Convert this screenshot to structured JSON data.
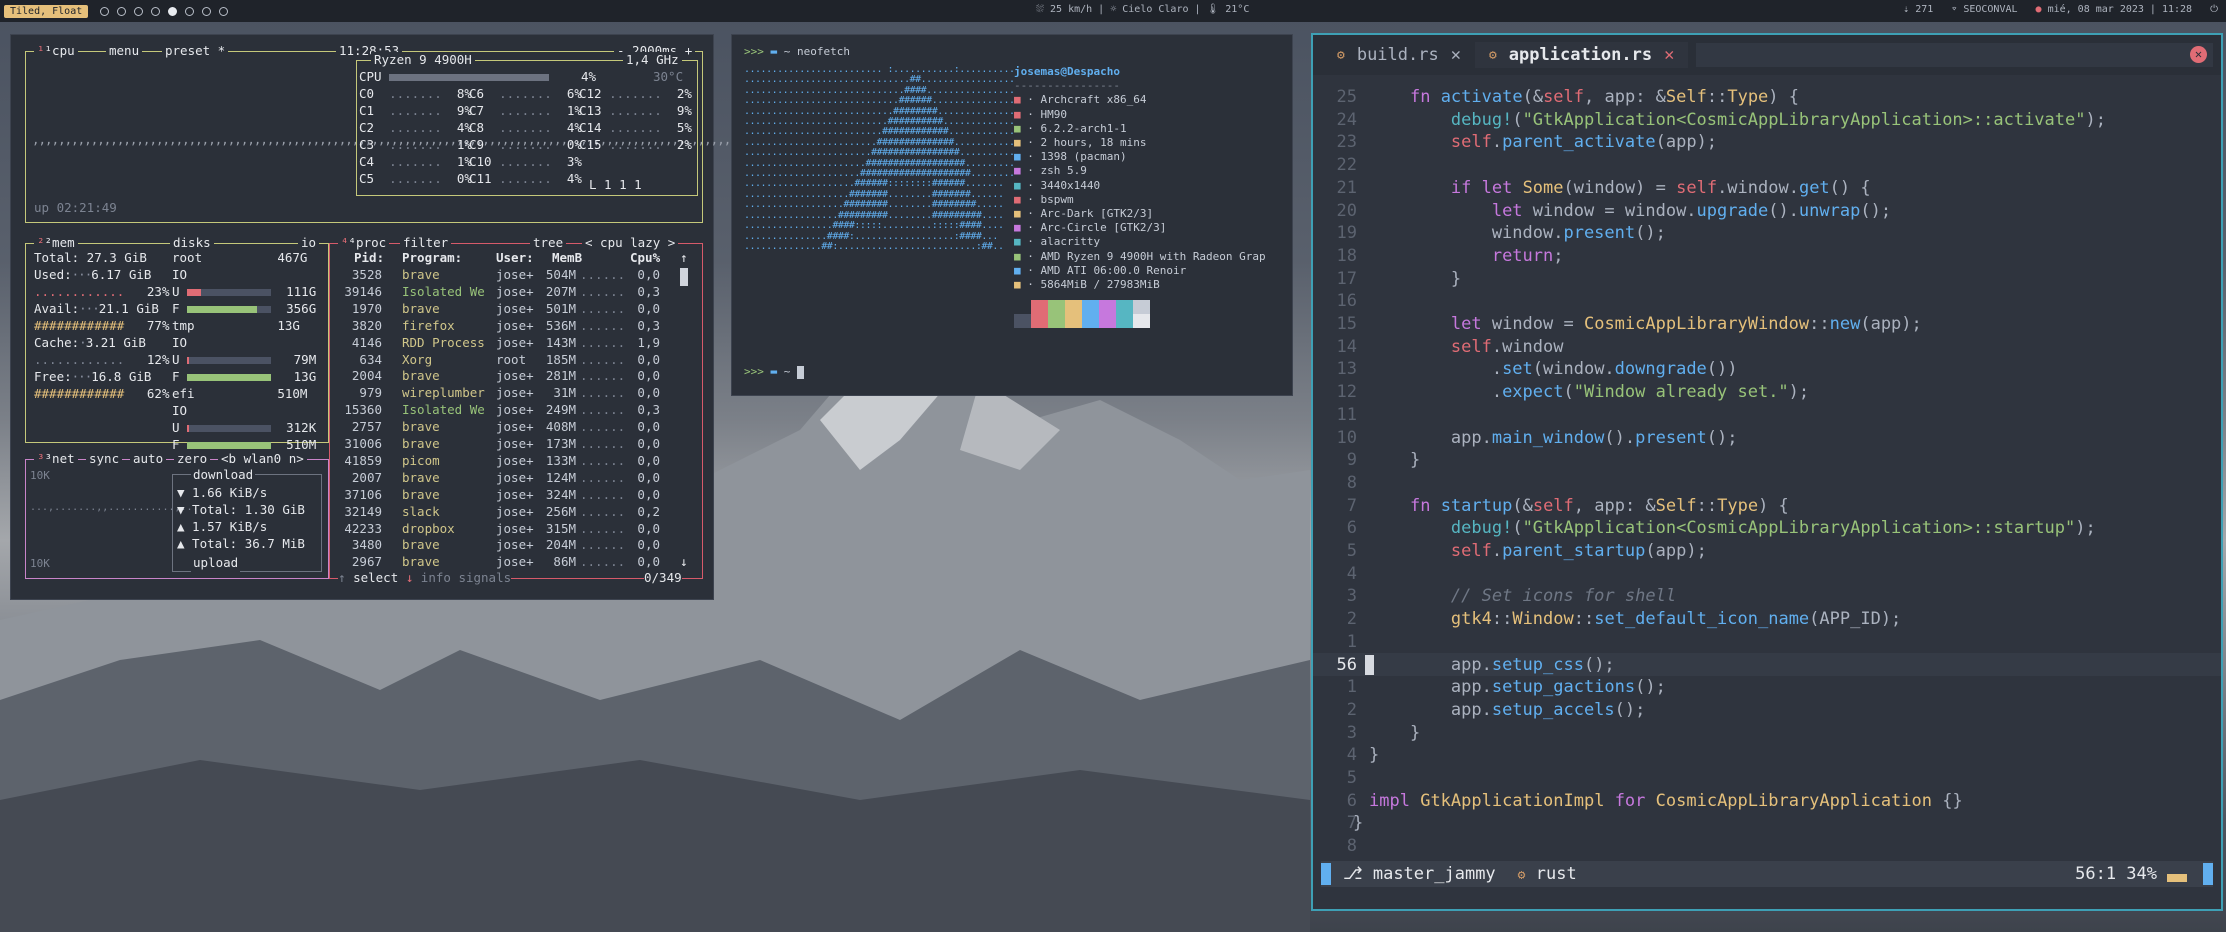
{
  "topbar": {
    "layout": "Tiled, Float",
    "center": "⛆ 25 km/h | ☼ Cielo Claro | 🌡 21°C",
    "updates": "271",
    "wifi": "SEOCONVAL",
    "datetime": "mié, 08 mar 2023 | 11:28"
  },
  "btop": {
    "cpu_title": "¹cpu",
    "menu": "menu",
    "preset": "preset *",
    "clock": "11:28:53",
    "interval": "- 2000ms +",
    "cpu_model": "Ryzen 9 4900H",
    "freq": "1,4 GHz",
    "cpu_total_label": "CPU",
    "cpu_total": "4%",
    "cpu_temp": "30°C",
    "cores": [
      [
        "C0",
        "8%"
      ],
      [
        "C1",
        "9%"
      ],
      [
        "C2",
        "4%"
      ],
      [
        "C3",
        "1%"
      ],
      [
        "C4",
        "1%"
      ],
      [
        "C5",
        "0%"
      ],
      [
        "C6",
        "6%"
      ],
      [
        "C7",
        "1%"
      ],
      [
        "C8",
        "4%"
      ],
      [
        "C9",
        "0%"
      ],
      [
        "C10",
        "3%"
      ],
      [
        "C11",
        "4%"
      ],
      [
        "C12",
        "2%"
      ],
      [
        "C13",
        "9%"
      ],
      [
        "C14",
        "5%"
      ],
      [
        "C15",
        "2%"
      ]
    ],
    "load": "L 1 1 1",
    "uptime": "up 02:21:49",
    "mem_title": "²mem",
    "disks_title": "disks",
    "io_title": "io",
    "mem": {
      "total": "Total: 27.3 GiB",
      "used": "Used:",
      "used_val": "6.17 GiB",
      "used_pct": "23%",
      "avail": "Avail:",
      "avail_val": "21.1 GiB",
      "avail_pct": "77%",
      "cache": "Cache:",
      "cache_val": "3.21 GiB",
      "cache_pct": "12%",
      "free": "Free:",
      "free_val": "16.8 GiB",
      "free_pct": "62%"
    },
    "disks": [
      {
        "name": "root",
        "size": "467G",
        "used": "111G",
        "free": "356G"
      },
      {
        "name": "tmp",
        "size": "13G",
        "used": "79M",
        "free": "13G"
      },
      {
        "name": "efi",
        "size": "510M",
        "used": "312K",
        "free": "510M"
      }
    ],
    "net_title": "³net",
    "net_sync": "sync",
    "net_auto": "auto",
    "net_zero": "zero",
    "net_iface": "<b wlan0 n>",
    "net_scale_top": "10K",
    "net_scale_bot": "10K",
    "net_download": "download",
    "net_down_rate": "▼ 1.66 KiB/s",
    "net_down_total": "▼ Total: 1.30 GiB",
    "net_up_rate": "▲ 1.57 KiB/s",
    "net_up_total": "▲ Total: 36.7 MiB",
    "net_upload": "upload",
    "proc_title": "⁴proc",
    "proc_filter": "filter",
    "proc_tree": "tree",
    "proc_sort": "< cpu lazy >",
    "proc_headers": [
      "Pid:",
      "Program:",
      "User:",
      "MemB",
      "Cpu%"
    ],
    "procs": [
      [
        "3528",
        "brave",
        "jose+",
        "504M",
        "0,0"
      ],
      [
        "39146",
        "Isolated We",
        "jose+",
        "207M",
        "0,3"
      ],
      [
        "1970",
        "brave",
        "jose+",
        "501M",
        "0,0"
      ],
      [
        "3820",
        "firefox",
        "jose+",
        "536M",
        "0,3"
      ],
      [
        "4146",
        "RDD Process",
        "jose+",
        "143M",
        "1,9"
      ],
      [
        "634",
        "Xorg",
        "root",
        "185M",
        "0,0"
      ],
      [
        "2004",
        "brave",
        "jose+",
        "281M",
        "0,0"
      ],
      [
        "979",
        "wireplumber",
        "jose+",
        "31M",
        "0,0"
      ],
      [
        "15360",
        "Isolated We",
        "jose+",
        "249M",
        "0,3"
      ],
      [
        "2757",
        "brave",
        "jose+",
        "408M",
        "0,0"
      ],
      [
        "31006",
        "brave",
        "jose+",
        "173M",
        "0,0"
      ],
      [
        "41859",
        "picom",
        "jose+",
        "133M",
        "0,0"
      ],
      [
        "2007",
        "brave",
        "jose+",
        "124M",
        "0,0"
      ],
      [
        "37106",
        "brave",
        "jose+",
        "324M",
        "0,0"
      ],
      [
        "32149",
        "slack",
        "jose+",
        "256M",
        "0,2"
      ],
      [
        "42233",
        "dropbox",
        "jose+",
        "315M",
        "0,0"
      ],
      [
        "3480",
        "brave",
        "jose+",
        "204M",
        "0,0"
      ],
      [
        "2967",
        "brave",
        "jose+",
        "86M",
        "0,0"
      ]
    ],
    "proc_select": "select",
    "proc_info": "info",
    "proc_signals": "signals",
    "proc_count": "0/349"
  },
  "neofetch": {
    "prompt": ">>>",
    "dir": "~",
    "command": "neofetch",
    "user_host": "josemas@Despacho",
    "lines": [
      "· Archcraft x86_64",
      "· HM90",
      "· 6.2.2-arch1-1",
      "· 2 hours, 18 mins",
      "· 1398 (pacman)",
      "· zsh 5.9",
      "· 3440x1440",
      "· bspwm",
      "· Arc-Dark [GTK2/3]",
      "· Arc-Circle [GTK2/3]",
      "· alacritty",
      "· AMD Ryzen 9 4900H with Radeon Grap",
      "· AMD ATI 06:00.0 Renoir",
      "· 5864MiB / 27983MiB"
    ],
    "colors": [
      "#2b3039",
      "#e06c75",
      "#98c379",
      "#e5c07b",
      "#61afef",
      "#c678dd",
      "#56b6c2",
      "#c6ccd6"
    ],
    "colors_bright": [
      "#4b5263",
      "#e06c75",
      "#98c379",
      "#e5c07b",
      "#61afef",
      "#c678dd",
      "#56b6c2",
      "#e6e8ec"
    ]
  },
  "editor": {
    "tabs": [
      {
        "name": "build.rs",
        "active": false
      },
      {
        "name": "application.rs",
        "active": true
      }
    ],
    "tab_close": "✕",
    "status": {
      "branch": "master_jammy",
      "lang": "rust",
      "position": "56:1 34%"
    }
  }
}
